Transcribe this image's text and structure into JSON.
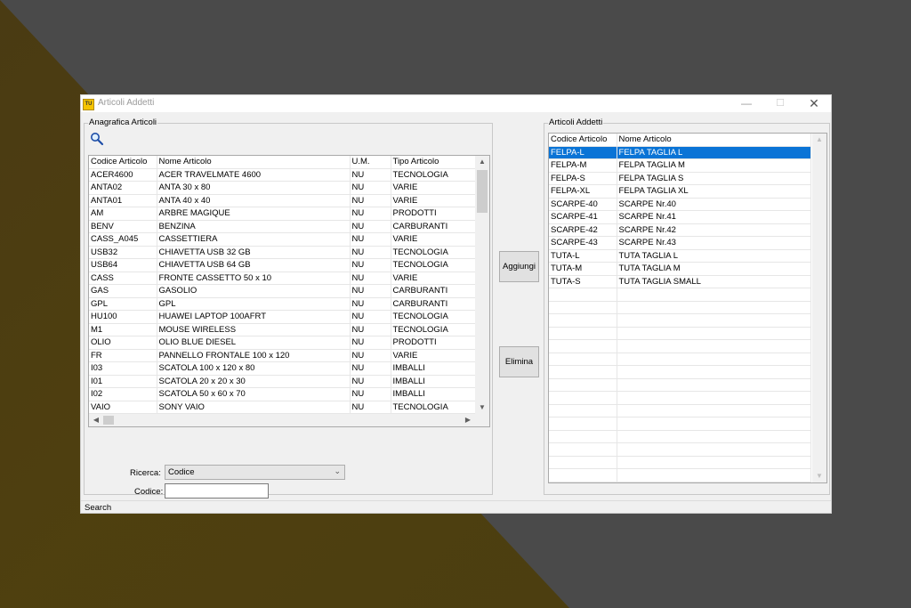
{
  "window": {
    "title": "Articoli Addetti",
    "app_icon_text": "TU"
  },
  "left_panel": {
    "group_label": "Anagrafica Articoli",
    "columns": [
      "Codice Articolo",
      "Nome Articolo",
      "U.M.",
      "Tipo Articolo"
    ],
    "rows": [
      [
        "ACER4600",
        "ACER TRAVELMATE 4600",
        "NU",
        "TECNOLOGIA"
      ],
      [
        "ANTA02",
        "ANTA 30 x 80",
        "NU",
        "VARIE"
      ],
      [
        "ANTA01",
        "ANTA 40 x 40",
        "NU",
        "VARIE"
      ],
      [
        "AM",
        "ARBRE MAGIQUE",
        "NU",
        "PRODOTTI"
      ],
      [
        "BENV",
        "BENZINA",
        "NU",
        "CARBURANTI"
      ],
      [
        "CASS_A045",
        "CASSETTIERA",
        "NU",
        "VARIE"
      ],
      [
        "USB32",
        "CHIAVETTA USB 32 GB",
        "NU",
        "TECNOLOGIA"
      ],
      [
        "USB64",
        "CHIAVETTA USB 64 GB",
        "NU",
        "TECNOLOGIA"
      ],
      [
        "CASS",
        "FRONTE CASSETTO 50 x 10",
        "NU",
        "VARIE"
      ],
      [
        "GAS",
        "GASOLIO",
        "NU",
        "CARBURANTI"
      ],
      [
        "GPL",
        "GPL",
        "NU",
        "CARBURANTI"
      ],
      [
        "HU100",
        "HUAWEI LAPTOP 100AFRT",
        "NU",
        "TECNOLOGIA"
      ],
      [
        "M1",
        "MOUSE WIRELESS",
        "NU",
        "TECNOLOGIA"
      ],
      [
        "OLIO",
        "OLIO BLUE DIESEL",
        "NU",
        "PRODOTTI"
      ],
      [
        "FR",
        "PANNELLO FRONTALE 100 x 120",
        "NU",
        "VARIE"
      ],
      [
        "I03",
        "SCATOLA 100 x 120 x 80",
        "NU",
        "IMBALLI"
      ],
      [
        "I01",
        "SCATOLA 20 x 20 x 30",
        "NU",
        "IMBALLI"
      ],
      [
        "I02",
        "SCATOLA 50 x 60 x 70",
        "NU",
        "IMBALLI"
      ],
      [
        "VAIO",
        "SONY VAIO",
        "NU",
        "TECNOLOGIA"
      ]
    ],
    "search_label": "Ricerca:",
    "search_selected": "Codice",
    "code_label": "Codice:",
    "code_value": ""
  },
  "buttons": {
    "add": "Aggiungi",
    "remove": "Elimina"
  },
  "right_panel": {
    "group_label": "Articoli Addetti",
    "columns": [
      "Codice Articolo",
      "Nome Articolo"
    ],
    "rows": [
      [
        "FELPA-L",
        "FELPA TAGLIA L"
      ],
      [
        "FELPA-M",
        "FELPA TAGLIA M"
      ],
      [
        "FELPA-S",
        "FELPA TAGLIA S"
      ],
      [
        "FELPA-XL",
        "FELPA TAGLIA XL"
      ],
      [
        "SCARPE-40",
        "SCARPE Nr.40"
      ],
      [
        "SCARPE-41",
        "SCARPE Nr.41"
      ],
      [
        "SCARPE-42",
        "SCARPE Nr.42"
      ],
      [
        "SCARPE-43",
        "SCARPE Nr.43"
      ],
      [
        "TUTA-L",
        "TUTA TAGLIA L"
      ],
      [
        "TUTA-M",
        "TUTA TAGLIA M"
      ],
      [
        "TUTA-S",
        "TUTA TAGLIA SMALL"
      ]
    ],
    "selected_index": 0
  },
  "status": {
    "text": "Search"
  },
  "icons": {
    "search": "search-icon"
  },
  "colors": {
    "selection": "#0a74d6"
  }
}
